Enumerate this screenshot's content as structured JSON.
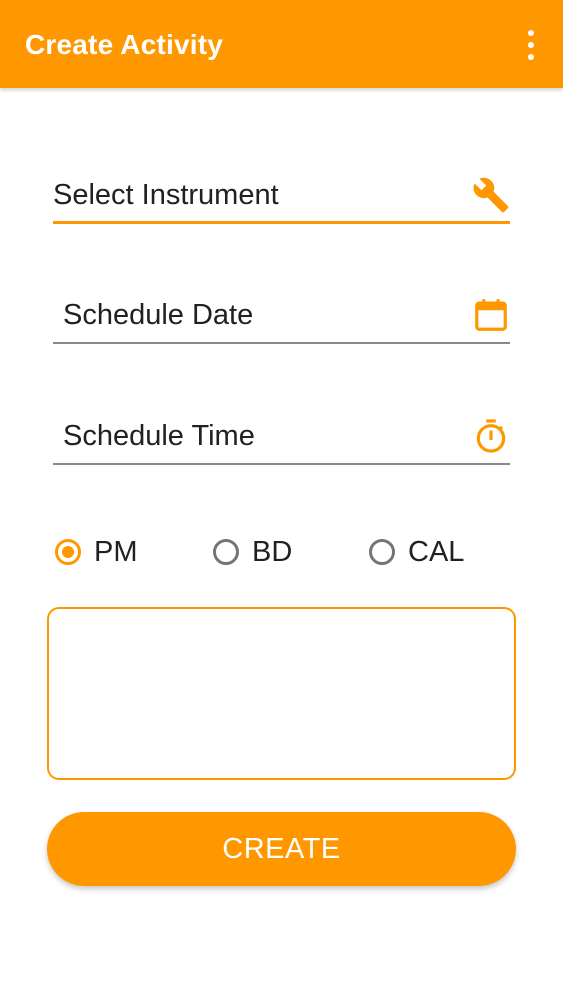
{
  "appbar": {
    "title": "Create Activity",
    "menu_icon": "more-vert-icon"
  },
  "colors": {
    "accent": "#FF9800",
    "text": "#212121",
    "underline": "#8a8a8a",
    "radio_unchecked": "#757575"
  },
  "fields": {
    "instrument": {
      "label": "Select Instrument",
      "icon": "wrench-icon",
      "focused": true
    },
    "date": {
      "label": "Schedule Date",
      "icon": "calendar-icon",
      "focused": false
    },
    "time": {
      "label": "Schedule Time",
      "icon": "stopwatch-icon",
      "focused": false
    }
  },
  "activity_type": {
    "options": [
      {
        "label": "PM",
        "checked": true
      },
      {
        "label": "BD",
        "checked": false
      },
      {
        "label": "CAL",
        "checked": false
      }
    ]
  },
  "notes": {
    "value": "",
    "placeholder": ""
  },
  "create_button": {
    "label": "CREATE"
  }
}
